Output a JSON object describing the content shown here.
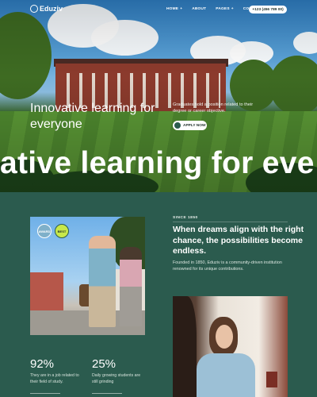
{
  "nav": {
    "logo": "Eduziv",
    "links": [
      {
        "label": "HOME",
        "has_caret": true
      },
      {
        "label": "ABOUT",
        "has_caret": false
      },
      {
        "label": "PAGES",
        "has_caret": true
      },
      {
        "label": "CONTACT",
        "has_caret": false
      }
    ],
    "phone": "+123 (456 789 00)"
  },
  "hero": {
    "title": "Innovative learning for everyone",
    "description": "Graduates hold a position related to their degree or career objective.",
    "cta_label": "APPLY NOW",
    "marquee": "ative learning for eve"
  },
  "about": {
    "since": "SINCE 1850",
    "heading": "When dreams align with the right chance, the possibilities become endless.",
    "description": "Founded in 1850, Eduziv is a community-driven institution renowned for its unique contributions."
  },
  "badges": [
    {
      "icon": "award-badge-icon",
      "text": "AWARD"
    },
    {
      "icon": "laurel-badge-icon",
      "text": "BEST"
    }
  ],
  "stats": [
    {
      "value": "92%",
      "description": "They are in a job related to their field of study."
    },
    {
      "value": "25%",
      "description": "Daily growing students are still grinding"
    }
  ],
  "colors": {
    "background": "#2b5b4e",
    "accent": "#c8e84a",
    "text": "#ffffff"
  }
}
